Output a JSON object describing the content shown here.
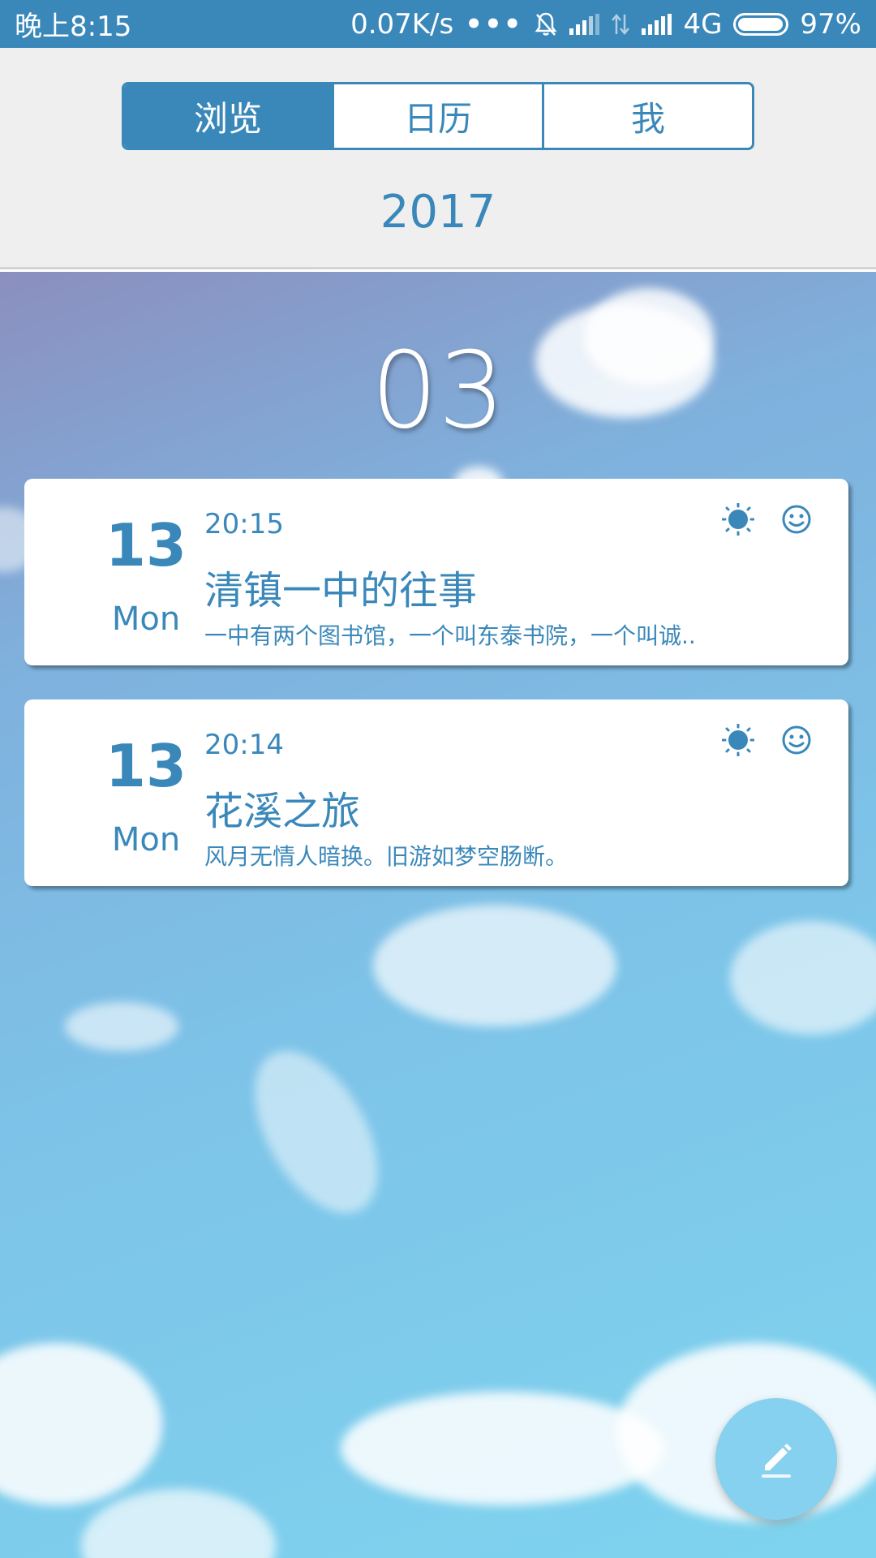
{
  "status_bar": {
    "time": "晚上8:15",
    "speed": "0.07K/s",
    "dots": "•••",
    "network": "4G",
    "battery": "97%"
  },
  "tabs": [
    {
      "label": "浏览",
      "active": true
    },
    {
      "label": "日历",
      "active": false
    },
    {
      "label": "我",
      "active": false
    }
  ],
  "year": "2017",
  "month": "03",
  "entries": [
    {
      "day": "13",
      "weekday": "Mon",
      "time": "20:15",
      "title": "清镇一中的往事",
      "snippet": "一中有两个图书馆，一个叫东泰书院，一个叫诚..",
      "weather_icon": "sun-icon",
      "mood_icon": "smiley-icon"
    },
    {
      "day": "13",
      "weekday": "Mon",
      "time": "20:14",
      "title": "花溪之旅",
      "snippet": "风月无情人暗换。旧游如梦空肠断。",
      "weather_icon": "sun-icon",
      "mood_icon": "smiley-icon"
    }
  ],
  "colors": {
    "accent": "#3a88ba",
    "fab": "#86d1ef",
    "header_bg": "#efefef"
  }
}
